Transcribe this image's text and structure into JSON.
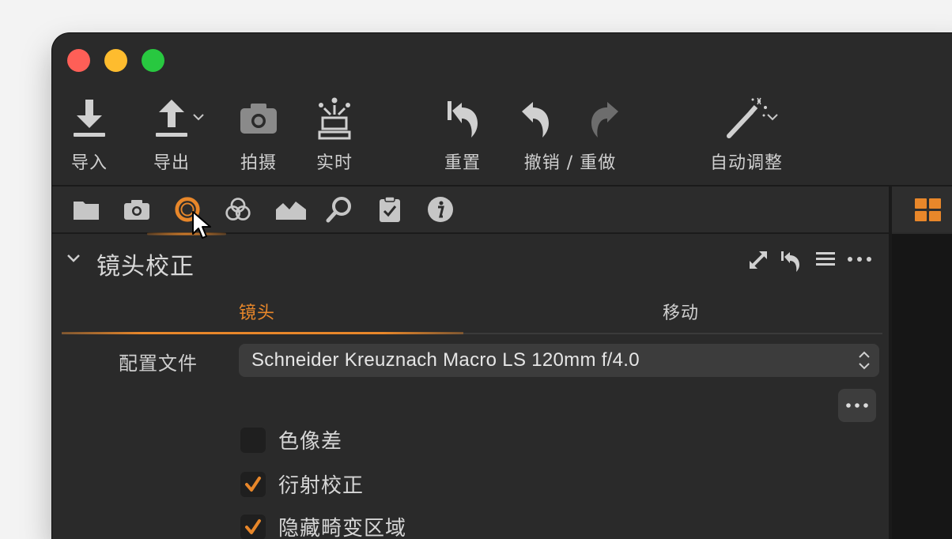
{
  "window": {
    "traffic_lights": [
      "close",
      "minimize",
      "zoom"
    ]
  },
  "toolbar": {
    "import_label": "导入",
    "export_label": "导出",
    "capture_label": "拍摄",
    "live_label": "实时",
    "reset_label": "重置",
    "undo_redo_label": "撤销 / 重做",
    "auto_adjust_label": "自动调整",
    "icons": [
      "import-icon",
      "export-icon",
      "camera-icon",
      "live-view-icon",
      "reset-icon",
      "undo-icon",
      "redo-icon",
      "magic-wand-icon"
    ]
  },
  "tool_tabs": {
    "icons": [
      "folder-icon",
      "camera-icon",
      "lens-icon",
      "color-icon",
      "exposure-icon",
      "details-icon",
      "adjustments-icon",
      "metadata-icon"
    ],
    "active": "lens-icon"
  },
  "section": {
    "title": "镜头校正",
    "actions": [
      "expand-icon",
      "reset-icon",
      "presets-icon",
      "more-icon"
    ]
  },
  "subtabs": {
    "lens": "镜头",
    "movement": "移动",
    "active": "lens"
  },
  "profile": {
    "label": "配置文件",
    "value": "Schneider Kreuznach Macro LS 120mm f/4.0"
  },
  "options": [
    {
      "label": "色像差",
      "checked": false
    },
    {
      "label": "衍射校正",
      "checked": true
    },
    {
      "label": "隐藏畸变区域",
      "checked": true
    }
  ],
  "colors": {
    "accent": "#e8872a",
    "background": "#2a2a2a"
  }
}
